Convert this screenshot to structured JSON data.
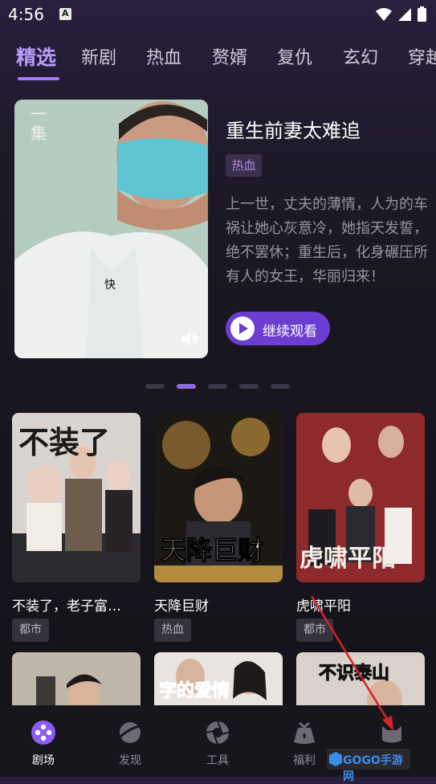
{
  "status_bar": {
    "time": "4:56"
  },
  "tabs": [
    {
      "label": "精选",
      "active": true
    },
    {
      "label": "新剧"
    },
    {
      "label": "热血"
    },
    {
      "label": "赘婿"
    },
    {
      "label": "复仇"
    },
    {
      "label": "玄幻"
    },
    {
      "label": "穿越"
    }
  ],
  "hero": {
    "cover_caption_vertical": "一集",
    "cover_caption_center": "快",
    "title": "重生前妻太难追",
    "tag": "热血",
    "description": "上一世，丈夫的薄情，人为的车祸让她心灰意冷，她指天发誓，绝不罢休；重生后，化身碾压所有人的女王，华丽归来！",
    "continue_label": "继续观看"
  },
  "carousel": {
    "count": 5,
    "active_index": 1
  },
  "dramas": [
    {
      "title": "不装了，老子富…",
      "tag": "都市",
      "poster_text": "不装了"
    },
    {
      "title": "天降巨财",
      "tag": "热血",
      "poster_text": "天降巨财"
    },
    {
      "title": "虎啸平阳",
      "tag": "都市",
      "poster_text": "虎啸平阳"
    },
    {
      "poster_text": ""
    },
    {
      "poster_text": "字的爱情"
    },
    {
      "poster_text": "不识泰山"
    }
  ],
  "bottom_nav": [
    {
      "label": "剧场",
      "icon": "theater-reel-icon",
      "active": true
    },
    {
      "label": "发现",
      "icon": "planet-icon"
    },
    {
      "label": "工具",
      "icon": "aperture-icon"
    },
    {
      "label": "福利",
      "icon": "gift-bag-icon"
    },
    {
      "label": "",
      "icon": "profile-cat-icon"
    }
  ],
  "watermark": {
    "text": "GOGO手游网"
  },
  "colors": {
    "accent": "#8d6cda",
    "button": "#6b3ed1",
    "annotation_arrow": "#d3242a"
  }
}
